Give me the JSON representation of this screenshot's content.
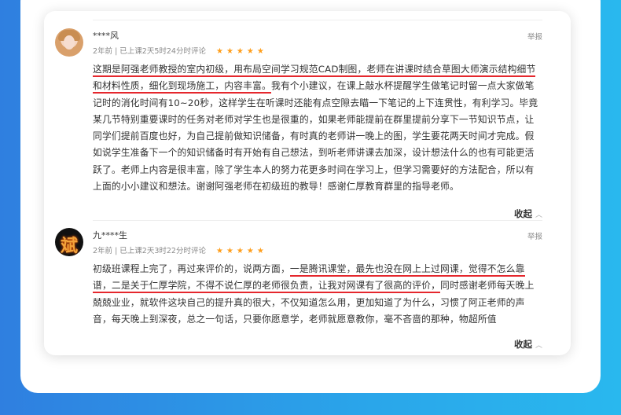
{
  "reviews": [
    {
      "username": "****风",
      "meta": "2年前 | 已上课2天5时24分时评论",
      "stars": "★★★★★",
      "report": "举报",
      "text_parts": [
        "这期是阿强老师教授的室内初级，用布局空间学习规范CAD制图，老师在讲课时结合草图大师演示结构细节和材料性质，细化到现场施工，内容丰富。",
        "我有个小建议，在课上敲水杯提醒学生做笔记时留一点大家做笔记时的消化时间有10~20秒，这样学生在听课时还能有点空隙去瞄一下笔记的上下连贯性，有利学习。毕竟某几节特别重要课时的任务对老师对学生也是很重的，如果老师能提前在群里提前分享下一节知识节点，让同学们提前百度也好，为自己提前做知识储备，有时真的老师讲一晚上的图，学生要花两天时间才完成。假如说学生准备下一个的知识储备时有开始有自己想法，到听老师讲课去加深，设计想法什么的也有可能更活跃了。老师上内容是很丰富，除了学生本人的努力花更多时间在学习上，但学习需要好的方法配合，所以有上面的小小建议和想法。谢谢阿强老师在初级班的教导！感谢仁厚教育群里的指导老师。"
      ],
      "collapse": "收起"
    },
    {
      "username": "九****生",
      "meta": "2年前 | 已上课2天3时22分时评论",
      "stars": "★★★★★",
      "report": "举报",
      "text_parts": [
        "初级班课程上完了，再过来评价的，说两方面，",
        "一是腾讯课堂，最先也没在网上上过网课，觉得不怎么靠谱，二是关于仁厚学院，不得不说仁厚的老师很负责，让我对网课有了很高的评价，",
        "同时感谢老师每天晚上兢兢业业，就软件这块自己的提升真的很大，不仅知道怎么用，更加知道了为什么，习惯了阿正老师的声音，每天晚上到深夜，总之一句话，只要你愿意学，老师就愿意教你，毫不吝啬的那种，物超所值"
      ],
      "collapse": "收起"
    }
  ],
  "colors": {
    "underline": "#e5272d",
    "star": "#ff9e1b",
    "background_left": "#2f7fe0",
    "background_right": "#29b8ee"
  },
  "icons": [
    "user-avatar",
    "star-icon",
    "chevron-up-icon"
  ]
}
